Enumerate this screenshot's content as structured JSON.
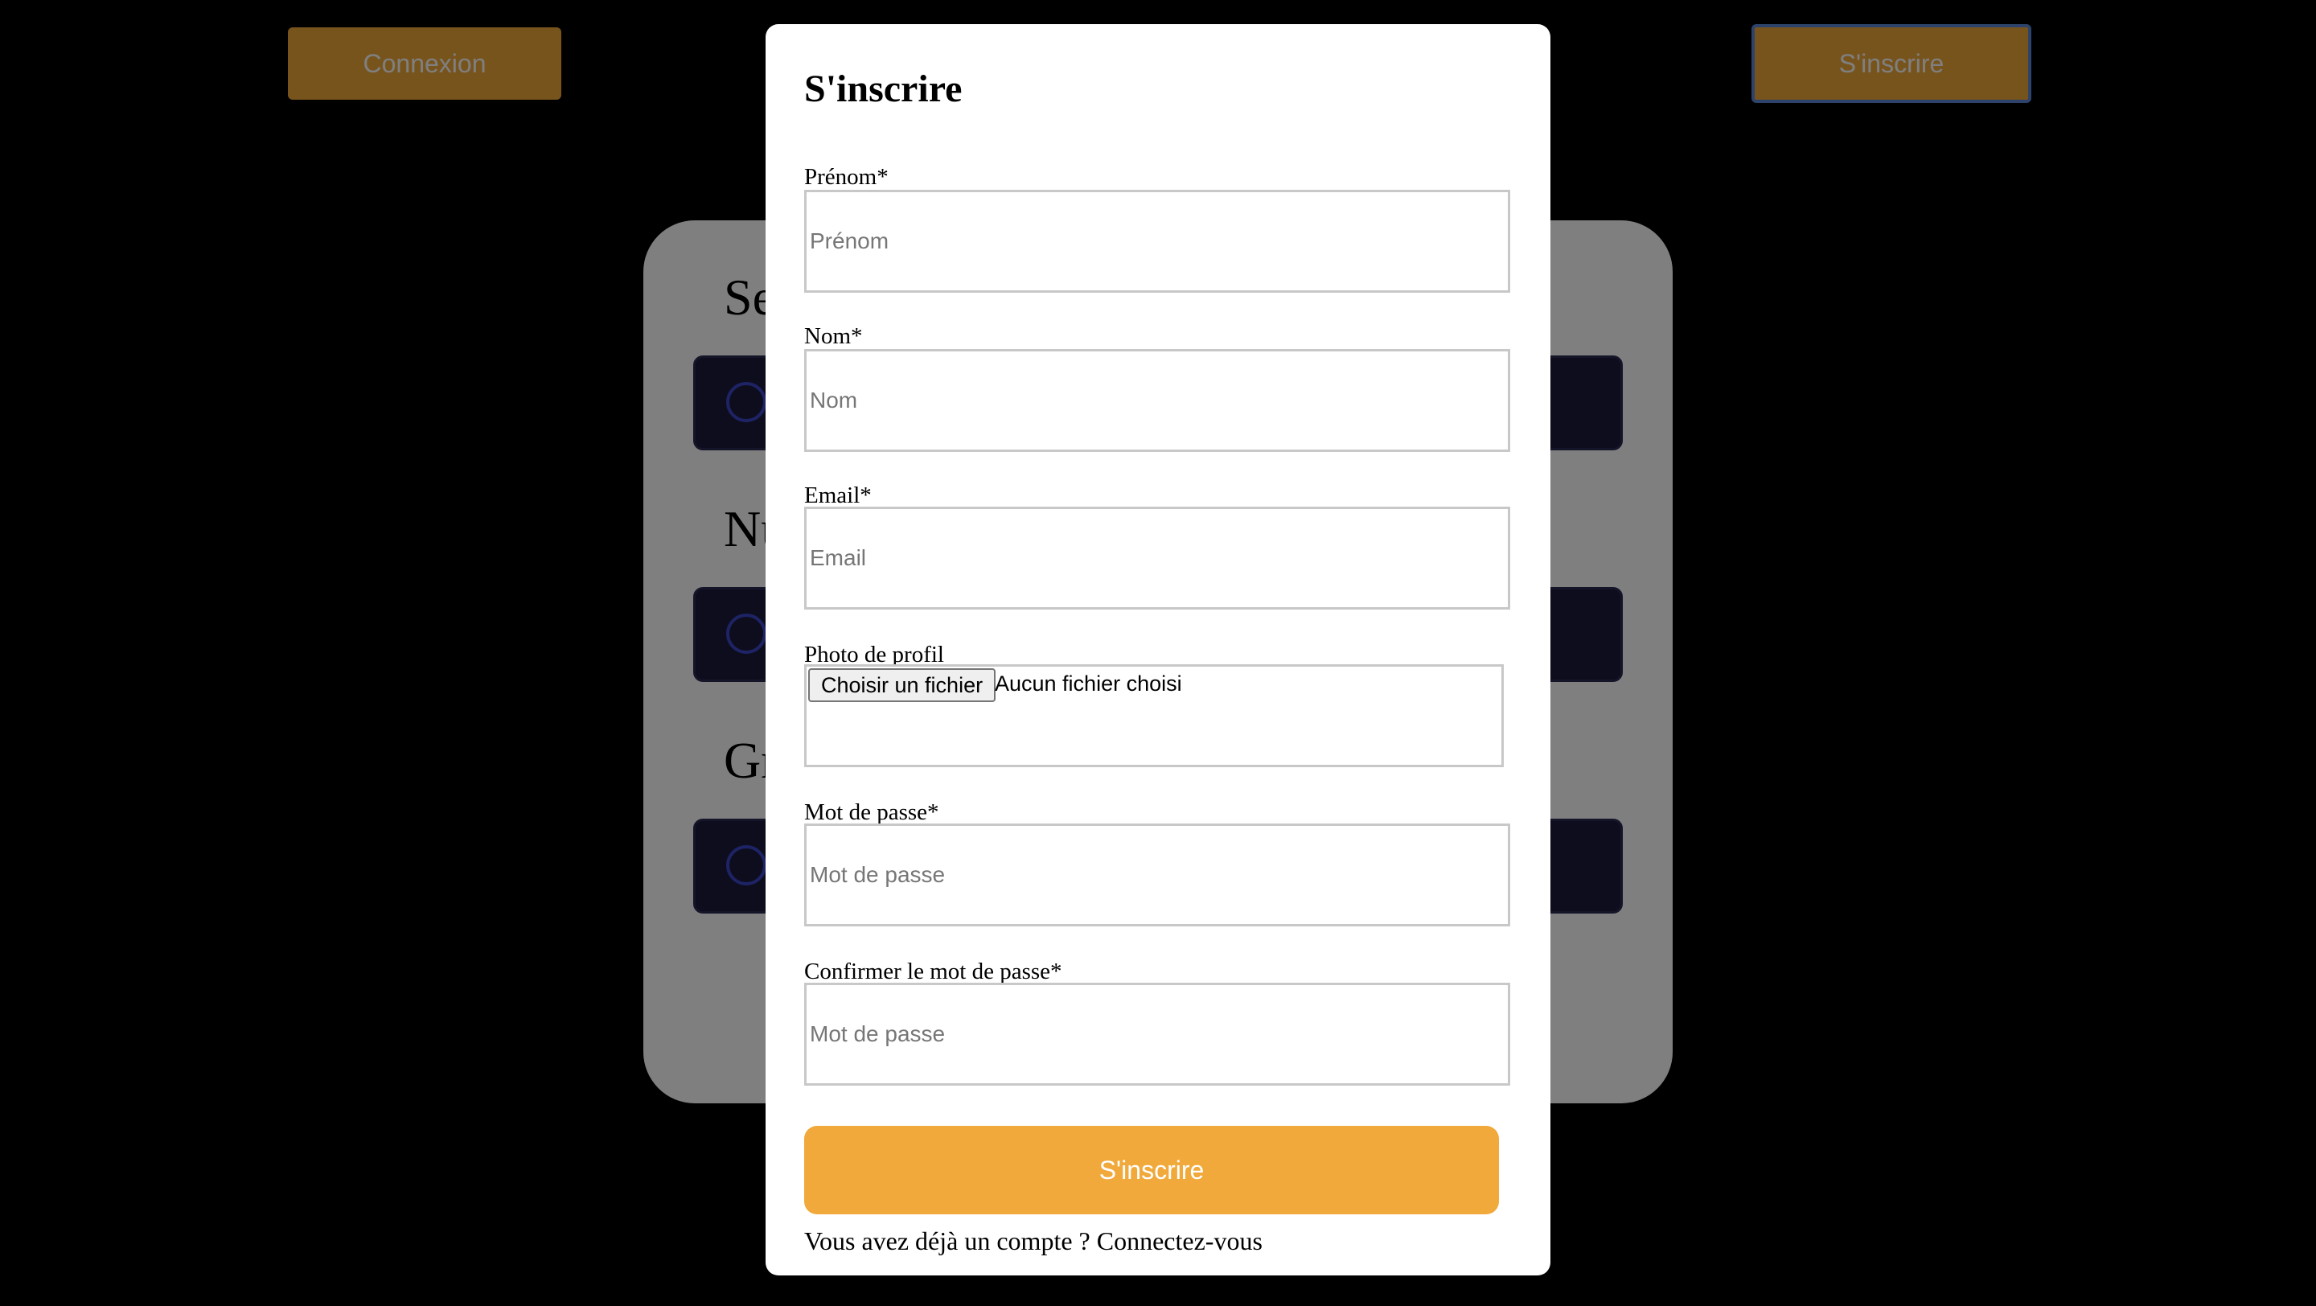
{
  "header": {
    "login_label": "Connexion",
    "register_label": "S'inscrire"
  },
  "background_card": {
    "headings": [
      "Se",
      "Nu",
      "Gr"
    ]
  },
  "signup_modal": {
    "title": "S'inscrire",
    "fields": {
      "first_name": {
        "label": "Prénom*",
        "placeholder": "Prénom",
        "value": ""
      },
      "last_name": {
        "label": "Nom*",
        "placeholder": "Nom",
        "value": ""
      },
      "email": {
        "label": "Email*",
        "placeholder": "Email",
        "value": ""
      },
      "profile_photo": {
        "label": "Photo de profil",
        "button_label": "Choisir un fichier",
        "status": "Aucun fichier choisi"
      },
      "password": {
        "label": "Mot de passe*",
        "placeholder": "Mot de passe",
        "value": ""
      },
      "confirm_password": {
        "label": "Confirmer le mot de passe*",
        "placeholder": "Mot de passe",
        "value": ""
      }
    },
    "submit_label": "S'inscrire",
    "login_prompt": {
      "text": "Vous avez déjà un compte ? ",
      "link": "Connectez-vous"
    }
  },
  "colors": {
    "accent": "#f0a93a",
    "overlay": "rgba(0,0,0,0.5)",
    "radio": "#3b46c9",
    "row_bg": "#1d1b3a"
  },
  "icons": {
    "radio": "radio-circle-icon"
  }
}
